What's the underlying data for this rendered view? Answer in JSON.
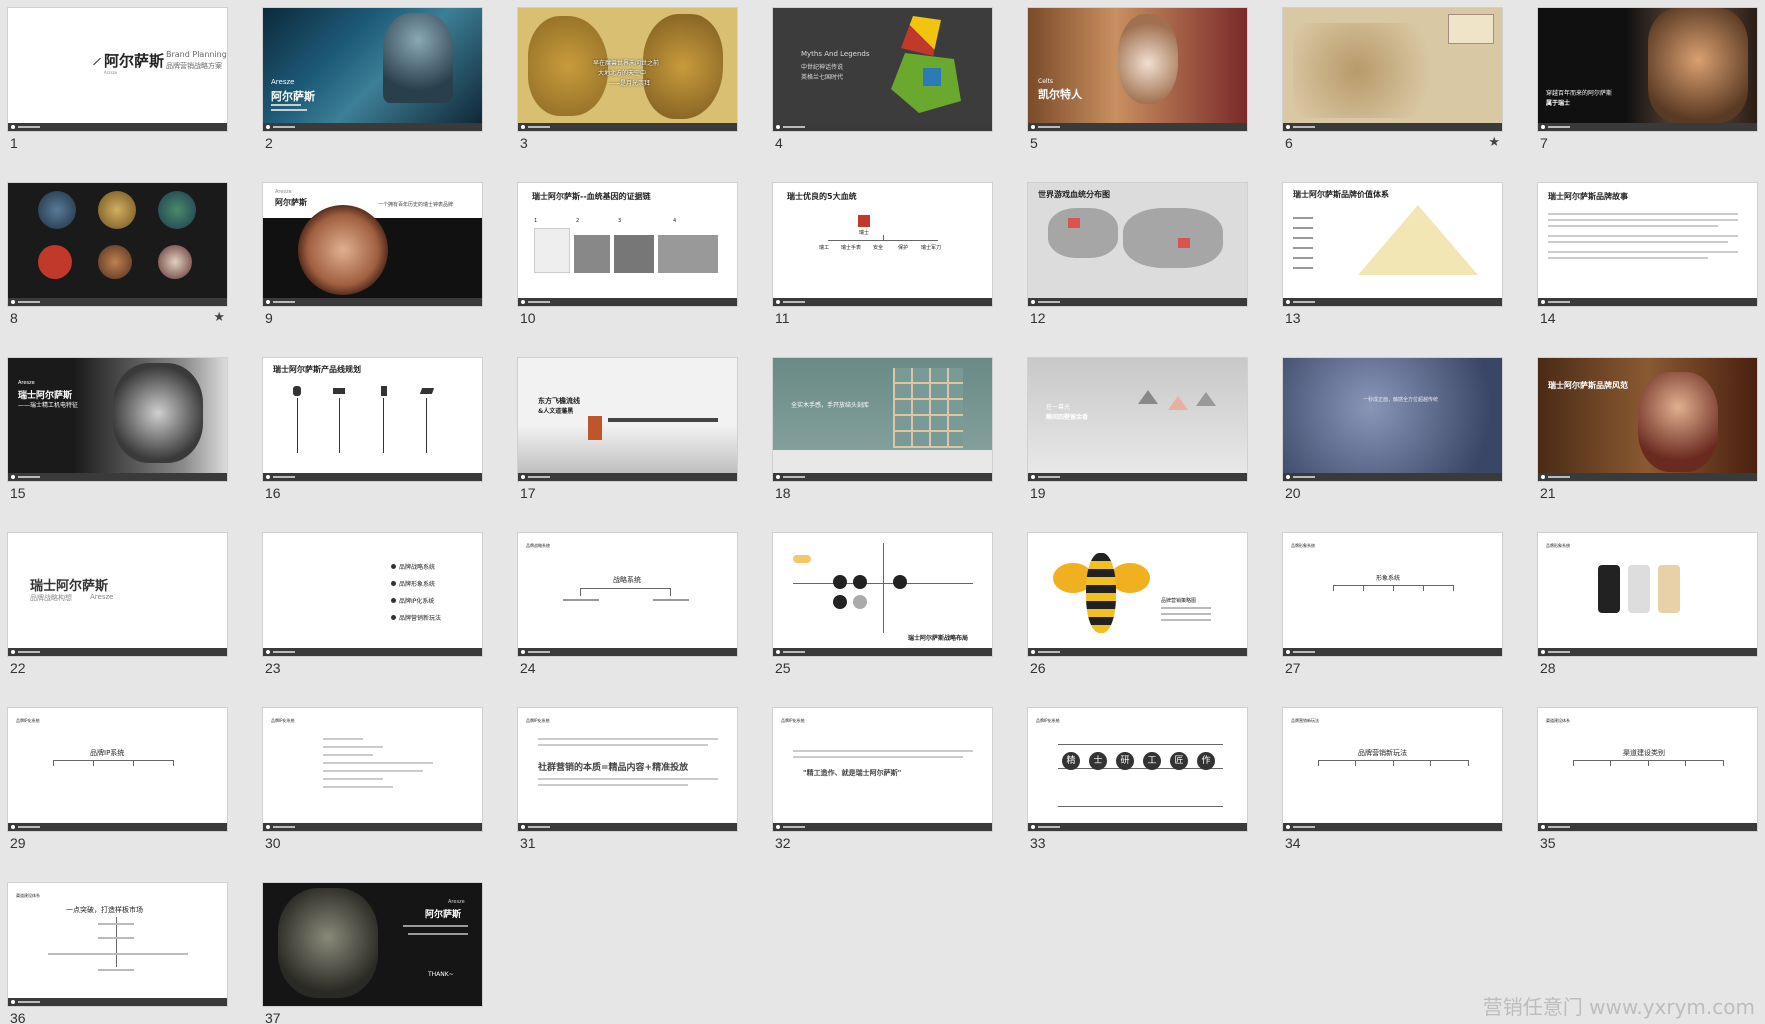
{
  "slides": [
    {
      "num": "1",
      "title": "阿尔萨斯",
      "sub_en": "Brand Planning",
      "sub_cn": "品牌营销战略方案",
      "tiny": "Arzsze"
    },
    {
      "num": "2",
      "en": "Aresze",
      "title": "阿尔萨斯"
    },
    {
      "num": "3",
      "line1": "早在魔兽世界未问世之前",
      "line2": "大地北方的天空中",
      "line3": "——是月光崇拜"
    },
    {
      "num": "4",
      "line1": "Myths And Legends",
      "line2": "中世纪神话传说",
      "line3": "英格兰七国时代"
    },
    {
      "num": "5",
      "en": "Celts",
      "title": "凯尔特人"
    },
    {
      "num": "6",
      "star": "★"
    },
    {
      "num": "7",
      "line1": "穿越百年而来的阿尔萨斯",
      "line2": "属于瑞士"
    },
    {
      "num": "8",
      "star": "★"
    },
    {
      "num": "9",
      "en": "Aresze",
      "title": "阿尔萨斯",
      "tag": "一个拥有百年历史的瑞士钟表品牌"
    },
    {
      "num": "10",
      "title": "瑞士阿尔萨斯--血统基因的证据链",
      "n1": "1",
      "n2": "2",
      "n3": "3",
      "n4": "4"
    },
    {
      "num": "11",
      "title": "瑞士优良的5大血统",
      "root": "瑞士",
      "items": [
        "瑞工",
        "瑞士手表",
        "安全",
        "保护",
        "瑞士军刀"
      ]
    },
    {
      "num": "12",
      "title": "世界游戏血统分布图"
    },
    {
      "num": "13",
      "title": "瑞士阿尔萨斯品牌价值体系"
    },
    {
      "num": "14",
      "title": "瑞士阿尔萨斯品牌故事"
    },
    {
      "num": "15",
      "en": "Aresze",
      "title": "瑞士阿尔萨斯",
      "sub": "——瑞士精工机电特征"
    },
    {
      "num": "16",
      "title": "瑞士阿尔萨斯产品线规划"
    },
    {
      "num": "17",
      "line1": "东方飞檐流线",
      "line2": "&人文道藩黑"
    },
    {
      "num": "18",
      "line1": "全实木手感，手开放结头刻库"
    },
    {
      "num": "19",
      "line1": "任一幕光",
      "line2": "瞬间四壁留余香"
    },
    {
      "num": "20",
      "line1": "一秒成正面，触感全方位超越传统"
    },
    {
      "num": "21",
      "title": "瑞士阿尔萨斯品牌风范"
    },
    {
      "num": "22",
      "title": "瑞士阿尔萨斯",
      "sub": "品牌战略构想",
      "en": "Aresze"
    },
    {
      "num": "23",
      "items": [
        "品牌战略系统",
        "品牌形象系统",
        "品牌IP化系统",
        "品牌营销新玩法"
      ]
    },
    {
      "num": "24",
      "head": "品牌战略系统",
      "root": "战略系统"
    },
    {
      "num": "25",
      "foot": "瑞士阿尔萨斯战略布局"
    },
    {
      "num": "26",
      "right": "品牌营销策略图"
    },
    {
      "num": "27",
      "head": "品牌形象系统",
      "root": "形象系统"
    },
    {
      "num": "28",
      "head": "品牌形象系统"
    },
    {
      "num": "29",
      "head": "品牌IP化系统",
      "root": "品牌IP系统"
    },
    {
      "num": "30",
      "head": "品牌IP化系统"
    },
    {
      "num": "31",
      "head": "品牌IP化系统",
      "big": "社群营销的本质=精品内容+精准投放"
    },
    {
      "num": "32",
      "head": "品牌IP化系统",
      "quote": "\"精工造作、就是瑞士阿尔萨斯\""
    },
    {
      "num": "33",
      "head": "品牌IP化系统",
      "chars": [
        "精",
        "士",
        "研",
        "工",
        "匠",
        "作"
      ]
    },
    {
      "num": "34",
      "head": "品牌营销新玩法",
      "root": "品牌营销新玩法"
    },
    {
      "num": "35",
      "head": "渠道建设体系",
      "root": "渠道建设类别"
    },
    {
      "num": "36",
      "head": "渠道建设体系",
      "title": "一点突破，打造样板市场"
    },
    {
      "num": "37",
      "en": "Aresze",
      "title": "阿尔萨斯",
      "thanks": "THANK~"
    }
  ],
  "watermark": "营销任意门 www.yxrym.com"
}
